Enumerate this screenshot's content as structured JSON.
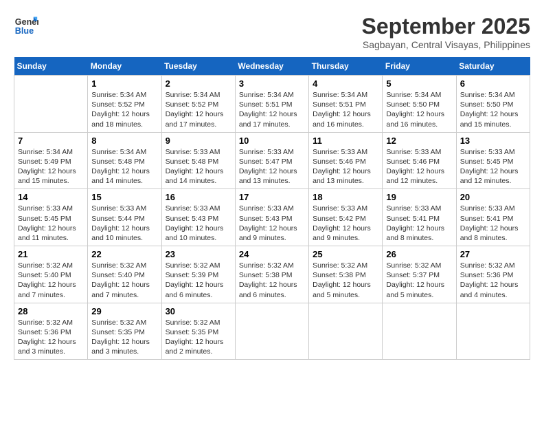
{
  "header": {
    "logo_line1": "General",
    "logo_line2": "Blue",
    "month": "September 2025",
    "location": "Sagbayan, Central Visayas, Philippines"
  },
  "days_of_week": [
    "Sunday",
    "Monday",
    "Tuesday",
    "Wednesday",
    "Thursday",
    "Friday",
    "Saturday"
  ],
  "weeks": [
    [
      {
        "day": "",
        "info": ""
      },
      {
        "day": "1",
        "info": "Sunrise: 5:34 AM\nSunset: 5:52 PM\nDaylight: 12 hours\nand 18 minutes."
      },
      {
        "day": "2",
        "info": "Sunrise: 5:34 AM\nSunset: 5:52 PM\nDaylight: 12 hours\nand 17 minutes."
      },
      {
        "day": "3",
        "info": "Sunrise: 5:34 AM\nSunset: 5:51 PM\nDaylight: 12 hours\nand 17 minutes."
      },
      {
        "day": "4",
        "info": "Sunrise: 5:34 AM\nSunset: 5:51 PM\nDaylight: 12 hours\nand 16 minutes."
      },
      {
        "day": "5",
        "info": "Sunrise: 5:34 AM\nSunset: 5:50 PM\nDaylight: 12 hours\nand 16 minutes."
      },
      {
        "day": "6",
        "info": "Sunrise: 5:34 AM\nSunset: 5:50 PM\nDaylight: 12 hours\nand 15 minutes."
      }
    ],
    [
      {
        "day": "7",
        "info": "Sunrise: 5:34 AM\nSunset: 5:49 PM\nDaylight: 12 hours\nand 15 minutes."
      },
      {
        "day": "8",
        "info": "Sunrise: 5:34 AM\nSunset: 5:48 PM\nDaylight: 12 hours\nand 14 minutes."
      },
      {
        "day": "9",
        "info": "Sunrise: 5:33 AM\nSunset: 5:48 PM\nDaylight: 12 hours\nand 14 minutes."
      },
      {
        "day": "10",
        "info": "Sunrise: 5:33 AM\nSunset: 5:47 PM\nDaylight: 12 hours\nand 13 minutes."
      },
      {
        "day": "11",
        "info": "Sunrise: 5:33 AM\nSunset: 5:46 PM\nDaylight: 12 hours\nand 13 minutes."
      },
      {
        "day": "12",
        "info": "Sunrise: 5:33 AM\nSunset: 5:46 PM\nDaylight: 12 hours\nand 12 minutes."
      },
      {
        "day": "13",
        "info": "Sunrise: 5:33 AM\nSunset: 5:45 PM\nDaylight: 12 hours\nand 12 minutes."
      }
    ],
    [
      {
        "day": "14",
        "info": "Sunrise: 5:33 AM\nSunset: 5:45 PM\nDaylight: 12 hours\nand 11 minutes."
      },
      {
        "day": "15",
        "info": "Sunrise: 5:33 AM\nSunset: 5:44 PM\nDaylight: 12 hours\nand 10 minutes."
      },
      {
        "day": "16",
        "info": "Sunrise: 5:33 AM\nSunset: 5:43 PM\nDaylight: 12 hours\nand 10 minutes."
      },
      {
        "day": "17",
        "info": "Sunrise: 5:33 AM\nSunset: 5:43 PM\nDaylight: 12 hours\nand 9 minutes."
      },
      {
        "day": "18",
        "info": "Sunrise: 5:33 AM\nSunset: 5:42 PM\nDaylight: 12 hours\nand 9 minutes."
      },
      {
        "day": "19",
        "info": "Sunrise: 5:33 AM\nSunset: 5:41 PM\nDaylight: 12 hours\nand 8 minutes."
      },
      {
        "day": "20",
        "info": "Sunrise: 5:33 AM\nSunset: 5:41 PM\nDaylight: 12 hours\nand 8 minutes."
      }
    ],
    [
      {
        "day": "21",
        "info": "Sunrise: 5:32 AM\nSunset: 5:40 PM\nDaylight: 12 hours\nand 7 minutes."
      },
      {
        "day": "22",
        "info": "Sunrise: 5:32 AM\nSunset: 5:40 PM\nDaylight: 12 hours\nand 7 minutes."
      },
      {
        "day": "23",
        "info": "Sunrise: 5:32 AM\nSunset: 5:39 PM\nDaylight: 12 hours\nand 6 minutes."
      },
      {
        "day": "24",
        "info": "Sunrise: 5:32 AM\nSunset: 5:38 PM\nDaylight: 12 hours\nand 6 minutes."
      },
      {
        "day": "25",
        "info": "Sunrise: 5:32 AM\nSunset: 5:38 PM\nDaylight: 12 hours\nand 5 minutes."
      },
      {
        "day": "26",
        "info": "Sunrise: 5:32 AM\nSunset: 5:37 PM\nDaylight: 12 hours\nand 5 minutes."
      },
      {
        "day": "27",
        "info": "Sunrise: 5:32 AM\nSunset: 5:36 PM\nDaylight: 12 hours\nand 4 minutes."
      }
    ],
    [
      {
        "day": "28",
        "info": "Sunrise: 5:32 AM\nSunset: 5:36 PM\nDaylight: 12 hours\nand 3 minutes."
      },
      {
        "day": "29",
        "info": "Sunrise: 5:32 AM\nSunset: 5:35 PM\nDaylight: 12 hours\nand 3 minutes."
      },
      {
        "day": "30",
        "info": "Sunrise: 5:32 AM\nSunset: 5:35 PM\nDaylight: 12 hours\nand 2 minutes."
      },
      {
        "day": "",
        "info": ""
      },
      {
        "day": "",
        "info": ""
      },
      {
        "day": "",
        "info": ""
      },
      {
        "day": "",
        "info": ""
      }
    ]
  ]
}
